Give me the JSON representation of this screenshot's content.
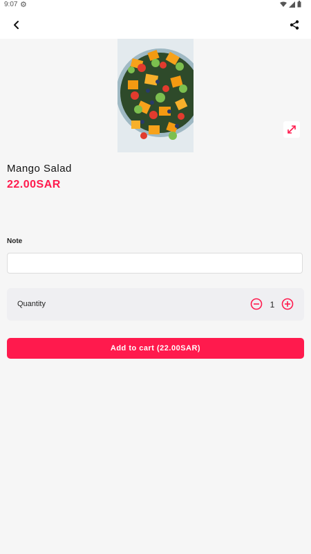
{
  "status_bar": {
    "time": "9:07",
    "icons": [
      "settings-icon",
      "wifi-icon",
      "signal-icon",
      "battery-icon"
    ]
  },
  "app_bar": {
    "back_icon": "back-arrow-icon",
    "share_icon": "share-icon"
  },
  "product": {
    "name": "Mango Salad",
    "price": "22.00SAR",
    "image": "fruit-salad-bowl-photo"
  },
  "note": {
    "label": "Note",
    "value": "",
    "placeholder": ""
  },
  "quantity": {
    "label": "Quantity",
    "value": "1"
  },
  "cart": {
    "button_label": "Add to cart (22.00SAR)"
  },
  "colors": {
    "accent": "#ff1a4d",
    "background": "#f6f6f6",
    "card": "#efeff2"
  }
}
